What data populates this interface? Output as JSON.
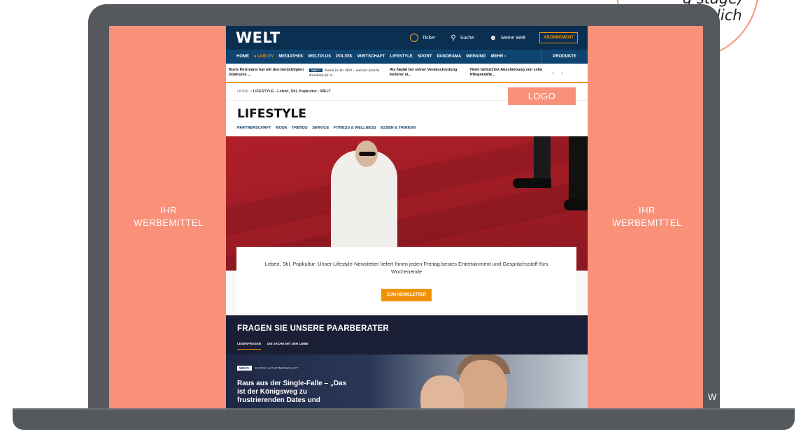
{
  "ad": {
    "left_line1": "IHR",
    "left_line2": "WERBEMITTEL",
    "right_line1": "IHR",
    "right_line2": "WERBEMITTEL",
    "logo_label": "LOGO",
    "bottom_right_fragment": "W"
  },
  "badge": {
    "line1": "g stage)",
    "line2": "möglich"
  },
  "site": {
    "logo": "WELT",
    "top": {
      "ticker": "Ticker",
      "search": "Suche",
      "account": "Meine Welt",
      "subscribe": "ABONNEMENT"
    },
    "nav": {
      "items": [
        "HOME",
        "LIVE-TV",
        "MEDIATHEK",
        "WELTPLUS",
        "POLITIK",
        "WIRTSCHAFT",
        "LIFESTYLE",
        "SPORT",
        "PANORAMA",
        "MEINUNG",
        "MEHR"
      ],
      "products": "PRODUKTE"
    },
    "teasers": [
      {
        "title": "Boris Herrmann hat mit den berüchtigten Doldrums ..."
      },
      {
        "tag": "WELT+",
        "title": "Panik in der SPD – und der falsche Kandidat für d..."
      },
      {
        "title": "Als Nadal bei seiner Verabschiedung Federer ei..."
      },
      {
        "title": "Heim befürchtet Abschiebung von zehn Pflegekräfte..."
      }
    ],
    "breadcrumb": {
      "home": "HOME",
      "sep": ">",
      "current": "LIFESTYLE - Leben, Stil, Popkultur - WELT"
    },
    "section_title": "LIFESTYLE",
    "subnav": [
      "PARTNERSCHAFT",
      "MODE",
      "TRENDS",
      "SERVICE",
      "FITNESS & WELLNESS",
      "ESSEN & TRINKEN"
    ],
    "newsletter": {
      "text": "Leben, Stil, Popkultur: Unser Lifestyle-Newsletter liefert Ihnen jeden Freitag bestes Entertainment und Gesprächsstoff fürs Wochenende",
      "button": "ZUM NEWSLETTER"
    },
    "advice": {
      "title": "FRAGEN SIE UNSERE PAARBERATER",
      "tabs": [
        "LESERFRAGEN",
        "DIE SACHE MIT DER LIEBE"
      ],
      "article": {
        "badge": "WELT+",
        "category": "DATING & PARTNERSCHAFT",
        "title": "Raus aus der Single-Falle – „Das ist der Königsweg zu frustrierenden Dates und"
      }
    }
  },
  "colors": {
    "ad_coral": "#f99179",
    "welt_navy": "#0b2f51",
    "accent_orange": "#f29200",
    "laptop_gray": "#55585d"
  }
}
